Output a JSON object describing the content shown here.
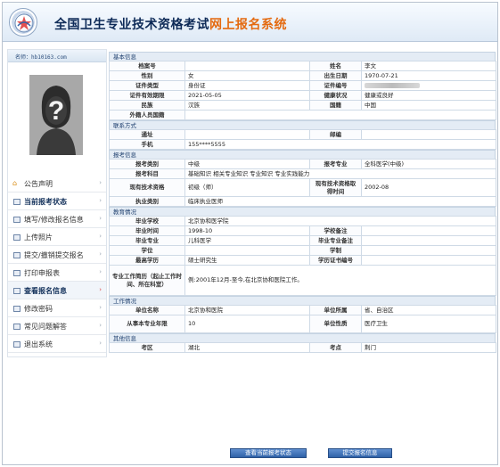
{
  "header": {
    "title_main": "全国卫生专业技术资格考试",
    "title_highlight": "网上报名系统",
    "logo_icon": "emblem-icon"
  },
  "sidebar": {
    "site": "名师：hb10163.com",
    "menu": [
      {
        "label": "公告声明",
        "icon": "home-icon"
      },
      {
        "label": "当前报考状态",
        "icon": "doc-icon"
      },
      {
        "label": "填写/修改报名信息",
        "icon": "doc-icon"
      },
      {
        "label": "上传照片",
        "icon": "doc-icon"
      },
      {
        "label": "提交/撤销提交报名",
        "icon": "doc-icon"
      },
      {
        "label": "打印申报表",
        "icon": "doc-icon"
      },
      {
        "label": "查看报名信息",
        "icon": "doc-icon"
      },
      {
        "label": "修改密码",
        "icon": "doc-icon"
      },
      {
        "label": "常见问题解答",
        "icon": "doc-icon"
      },
      {
        "label": "退出系统",
        "icon": "doc-icon"
      }
    ]
  },
  "sections": {
    "basic": "基本信息",
    "contact": "联系方式",
    "exam": "报考信息",
    "edu": "教育情况",
    "work": "工作情况",
    "other": "其他信息"
  },
  "basic": {
    "l_regno": "档案号",
    "regno": "",
    "l_name": "姓名",
    "name": "李文",
    "l_gender": "性别",
    "gender": "女",
    "l_birth": "出生日期",
    "birth": "1970-07-21",
    "l_idtype": "证件类型",
    "idtype": "身份证",
    "l_idno": "证件编号",
    "l_idexp": "证件有效期限",
    "idexp": "2021-05-05",
    "l_health": "健康状况",
    "health": "健康或良好",
    "l_ethnic": "民族",
    "ethnic": "汉族",
    "l_nation": "国籍",
    "nation": "中国",
    "l_foreign": "外籍人员国籍",
    "foreign": ""
  },
  "contact": {
    "l_addr": "通址",
    "addr": "",
    "l_zip": "邮编",
    "zip": "",
    "l_mobile": "手机",
    "mobile": "155****5555"
  },
  "exam": {
    "l_cat": "报考类别",
    "cat": "中级",
    "l_spec": "报考专业",
    "spec": "全科医学(中级)",
    "l_subj": "报考科目",
    "subj": "基础知识 相关专业知识 专业知识 专业实践能力",
    "l_curq": "现有技术资格",
    "curq": "初级（师）",
    "l_qdate": "现有技术资格取得时间",
    "qdate": "2002-08",
    "l_lic": "执业类别",
    "lic": "临床执业医师"
  },
  "edu": {
    "l_school": "毕业学校",
    "school": "北京协和医学院",
    "l_gdate": "毕业时间",
    "gdate": "1998-10",
    "l_xz": "学校备注",
    "xz": "",
    "l_major": "毕业专业",
    "major": "儿科医学",
    "l_mnote": "毕业专业备注",
    "mnote": "",
    "l_degree": "学位",
    "degree": "",
    "l_xuezhi": "学制",
    "xuezhi": "",
    "l_highest": "最高学历",
    "highest": "硕士研究生",
    "l_certno": "学历证书编号",
    "certno": "",
    "l_resume": "专业工作简历（起止工作时间、所在科室）",
    "resume": "例:2001年12月-至今,在北京协和医院工作。"
  },
  "work": {
    "l_unit": "单位名称",
    "unit": "北京协和医院",
    "l_region": "单位所属",
    "region": "省、自治区",
    "l_years": "从事本专业年限",
    "years": "10",
    "l_nature": "单位性质",
    "nature": "医疗卫生"
  },
  "other": {
    "l_area": "考区",
    "area": "湖北",
    "l_site": "考点",
    "site": "荆门"
  },
  "buttons": {
    "status": "查看当前报考状态",
    "submit": "提交报名信息"
  }
}
